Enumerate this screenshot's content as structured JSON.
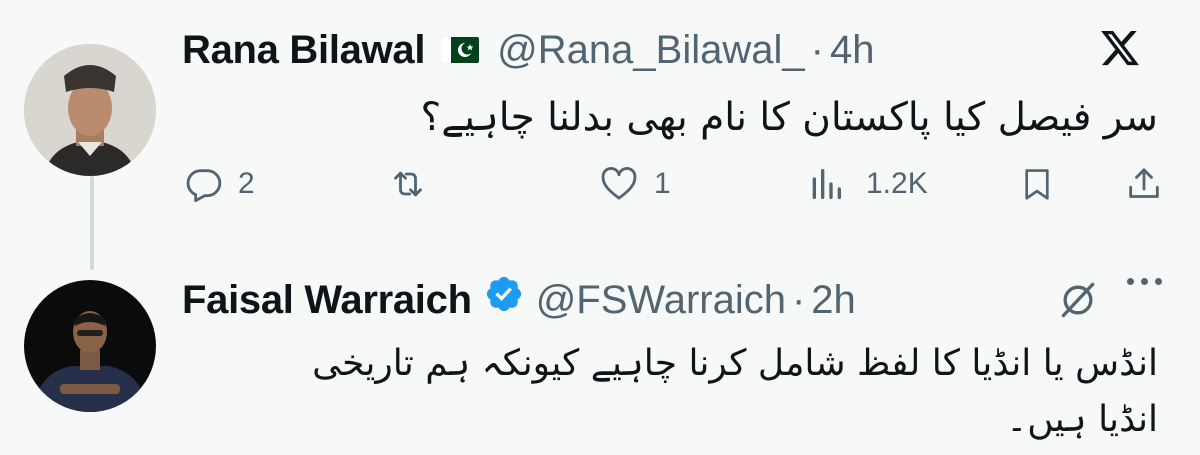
{
  "tweet1": {
    "name": "Rana Bilawal",
    "flag_icon": "pakistan-flag-icon",
    "handle": "@Rana_Bilawal_",
    "separator": "·",
    "time": "4h",
    "text": "سر فیصل کیا پاکستان کا نام بھی بدلنا چاہیے؟",
    "actions": {
      "replies": "2",
      "retweets": "",
      "likes": "1",
      "views": "1.2K"
    }
  },
  "tweet2": {
    "name": "Faisal Warraich",
    "verified_icon": "verified-badge-icon",
    "handle": "@FSWarraich",
    "separator": "·",
    "time": "2h",
    "text_line1": "انڈس یا انڈیا کا لفظ شامل کرنا چاہیے کیونکہ ہم  تاریخی",
    "text_line2": "انڈیا ہیں۔"
  },
  "icons": {
    "logo": "x-logo-icon",
    "grok": "grok-icon",
    "more": "more-dots-icon"
  },
  "colors": {
    "background": "#f7f9f9",
    "text": "#0f1419",
    "secondary": "#536471",
    "verified": "#1d9bf0",
    "flag_green": "#01411c"
  }
}
